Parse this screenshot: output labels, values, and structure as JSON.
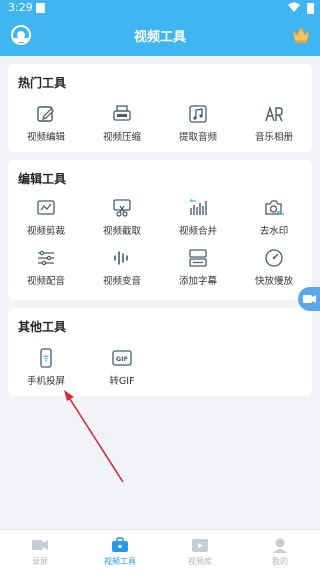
{
  "status": {
    "time": "3:29"
  },
  "header": {
    "title": "视频工具",
    "logo_icon": "eye-logo-icon",
    "crown_icon": "crown-icon"
  },
  "hot": {
    "title": "热门工具",
    "tools": [
      {
        "label": "视频编辑",
        "icon": "video-edit-icon"
      },
      {
        "label": "视频压缩",
        "icon": "video-compress-icon"
      },
      {
        "label": "提取音频",
        "icon": "extract-audio-icon"
      },
      {
        "label": "音乐相册",
        "icon": "music-album-icon"
      }
    ]
  },
  "edit": {
    "title": "编辑工具",
    "tools": [
      {
        "label": "视频剪裁",
        "icon": "crop-icon"
      },
      {
        "label": "视频截取",
        "icon": "scissors-icon"
      },
      {
        "label": "视频合并",
        "icon": "merge-icon"
      },
      {
        "label": "去水印",
        "icon": "remove-watermark-icon"
      },
      {
        "label": "视频配音",
        "icon": "dubbing-icon"
      },
      {
        "label": "视频变音",
        "icon": "voice-change-icon"
      },
      {
        "label": "添加字幕",
        "icon": "subtitle-icon"
      },
      {
        "label": "快放慢放",
        "icon": "speed-icon"
      }
    ]
  },
  "other": {
    "title": "其他工具",
    "tools": [
      {
        "label": "手机投屏",
        "icon": "screen-cast-icon"
      },
      {
        "label": "转GIF",
        "icon": "gif-icon",
        "badge": "GIF"
      }
    ]
  },
  "tabbar": {
    "tabs": [
      {
        "label": "录屏",
        "icon": "record-icon",
        "active": false
      },
      {
        "label": "视频工具",
        "icon": "toolbox-icon",
        "active": true
      },
      {
        "label": "视频库",
        "icon": "video-library-icon",
        "active": false
      },
      {
        "label": "我的",
        "icon": "profile-icon",
        "active": false
      }
    ]
  },
  "colors": {
    "accent": "#3fb6f2",
    "active_tab": "#2a9ae8",
    "icon_stroke": "#4a5a6a",
    "arrow": "#d9283b"
  }
}
